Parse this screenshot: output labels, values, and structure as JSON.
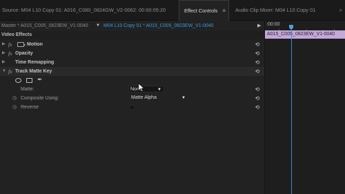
{
  "tabs": {
    "source": "Source: M04 L10 Copy 01: A016_C080_0824GW_V2-0062: 00:00:05:20",
    "effect_controls": "Effect Controls",
    "effect_controls_menu": "≡",
    "audio_mixer": "Audio Clip Mixer: M04 L10 Copy 01",
    "overflow": "»"
  },
  "clip_bar": {
    "master": "Master * A015_C005_0823EW_V1-0040",
    "dropdown_arrow": "▼",
    "sequence": "M04 L10 Copy 01 * A015_C005_0823EW_V1-0040",
    "play": "▶"
  },
  "video_effects": {
    "header": "Video Effects",
    "effects": [
      {
        "name": "Motion",
        "fx": "fx",
        "toggle": "▶",
        "reset": "⟲"
      },
      {
        "name": "Opacity",
        "fx": "fx",
        "toggle": "▶",
        "reset": "⟲"
      },
      {
        "name": "Time Remapping",
        "fx": "",
        "toggle": "▶",
        "reset": "⟲"
      },
      {
        "name": "Track Matte Key",
        "fx": "fx",
        "toggle": "▼",
        "reset": "⟲"
      }
    ],
    "properties": {
      "matte": {
        "label": "Matte:",
        "value": "None",
        "reset": "⟲"
      },
      "composite_using": {
        "label": "Composite Using:",
        "value": "Matte Alpha",
        "stopwatch": "◷",
        "reset": "⟲"
      },
      "reverse": {
        "label": "Reverse",
        "stopwatch": "◷",
        "checked": false,
        "reset": "⟲"
      }
    }
  },
  "timeline": {
    "timecode": ":00:00",
    "clip_name": "A015_C005_0823EW_V1-0040",
    "clip_color": "#c3a8d8",
    "playhead_color": "#3f8fd6"
  },
  "icons": [
    "motion-icon",
    "ellipse-mask-icon",
    "rectangle-mask-icon",
    "pen-mask-icon",
    "reset-icon",
    "stopwatch-icon",
    "play-icon"
  ]
}
